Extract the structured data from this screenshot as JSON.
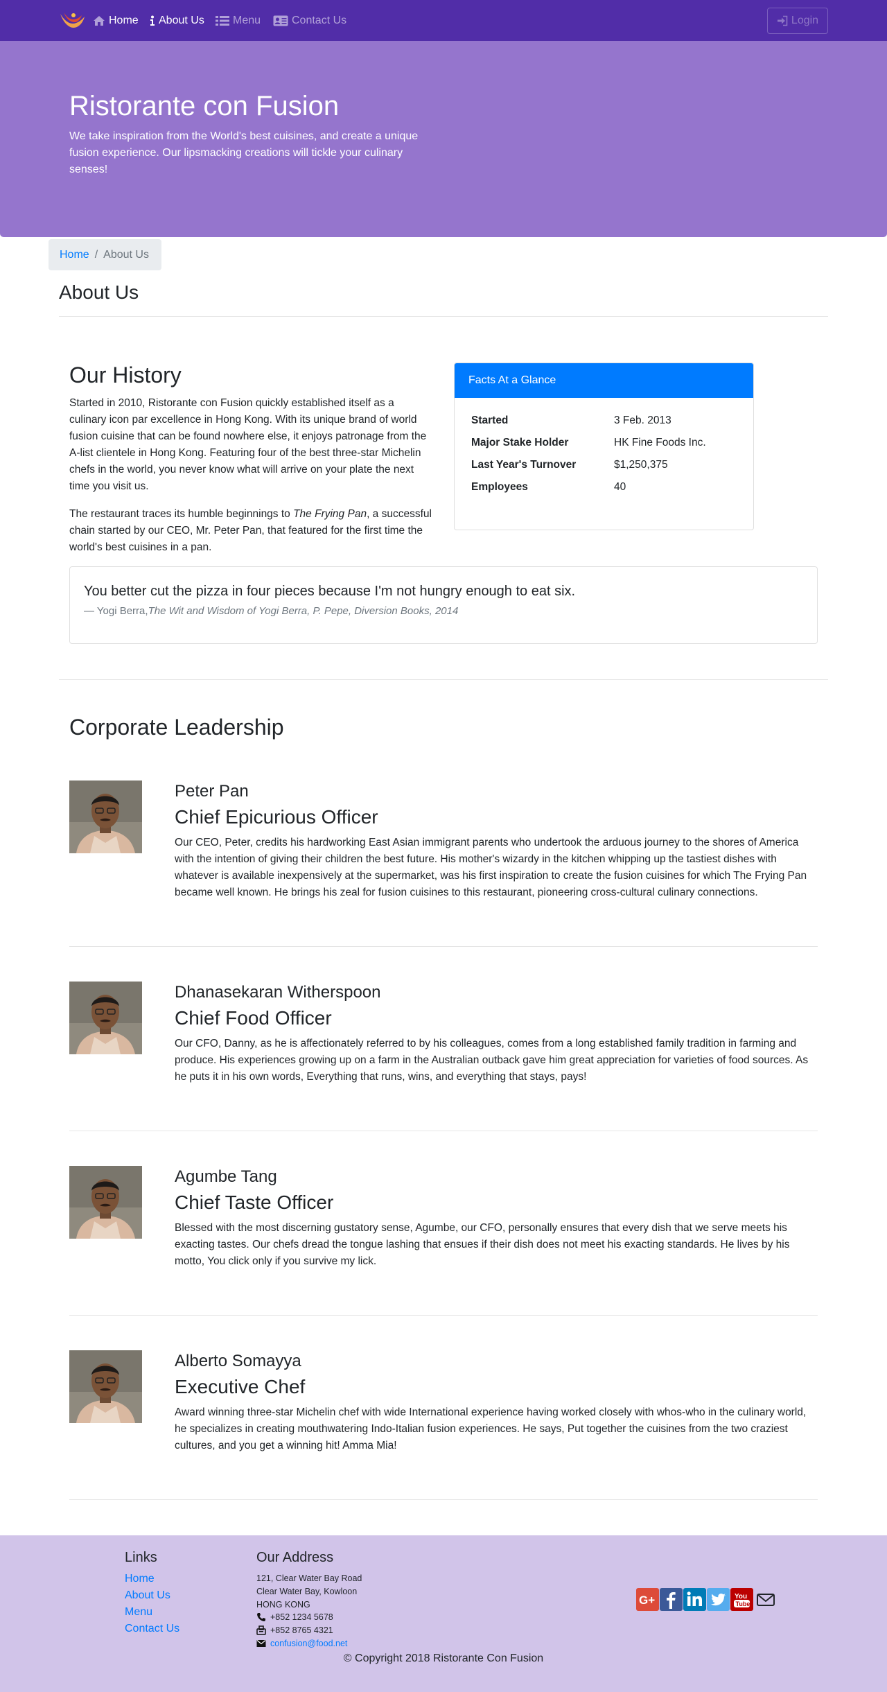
{
  "nav": {
    "items": [
      {
        "label": "Home"
      },
      {
        "label": "About Us"
      },
      {
        "label": "Menu"
      },
      {
        "label": "Contact Us"
      }
    ],
    "login_label": "Login"
  },
  "jumbotron": {
    "title": "Ristorante con Fusion",
    "text": "We take inspiration from the World's best cuisines, and create a unique fusion experience. Our lipsmacking creations will tickle your culinary senses!"
  },
  "breadcrumb": {
    "home": "Home",
    "current": "About Us"
  },
  "page_title": "About Us",
  "history": {
    "title": "Our History",
    "p1": "Started in 2010, Ristorante con Fusion quickly established itself as a culinary icon par excellence in Hong Kong. With its unique brand of world fusion cuisine that can be found nowhere else, it enjoys patronage from the A-list clientele in Hong Kong. Featuring four of the best three-star Michelin chefs in the world, you never know what will arrive on your plate the next time you visit us.",
    "p2_before": "The restaurant traces its humble beginnings to ",
    "p2_em": "The Frying Pan",
    "p2_after": ", a successful chain started by our CEO, Mr. Peter Pan, that featured for the first time the world's best cuisines in a pan."
  },
  "facts": {
    "header": "Facts At a Glance",
    "rows": [
      {
        "key": "Started",
        "value": "3 Feb. 2013"
      },
      {
        "key": "Major Stake Holder",
        "value": "HK Fine Foods Inc."
      },
      {
        "key": "Last Year's Turnover",
        "value": "$1,250,375"
      },
      {
        "key": "Employees",
        "value": "40"
      }
    ]
  },
  "quote": {
    "text": "You better cut the pizza in four pieces because I'm not hungry enough to eat six.",
    "author": "— Yogi Berra,",
    "cite": "The Wit and Wisdom of Yogi Berra, P. Pepe, Diversion Books, 2014"
  },
  "leadership": {
    "title": "Corporate Leadership",
    "leaders": [
      {
        "name": "Peter Pan",
        "role": "Chief Epicurious Officer",
        "description": "Our CEO, Peter, credits his hardworking East Asian immigrant parents who undertook the arduous journey to the shores of America with the intention of giving their children the best future. His mother's wizardy in the kitchen whipping up the tastiest dishes with whatever is available inexpensively at the supermarket, was his first inspiration to create the fusion cuisines for which The Frying Pan became well known. He brings his zeal for fusion cuisines to this restaurant, pioneering cross-cultural culinary connections."
      },
      {
        "name": "Dhanasekaran Witherspoon",
        "role": "Chief Food Officer",
        "description": "Our CFO, Danny, as he is affectionately referred to by his colleagues, comes from a long established family tradition in farming and produce. His experiences growing up on a farm in the Australian outback gave him great appreciation for varieties of food sources. As he puts it in his own words, Everything that runs, wins, and everything that stays, pays!"
      },
      {
        "name": "Agumbe Tang",
        "role": "Chief Taste Officer",
        "description": "Blessed with the most discerning gustatory sense, Agumbe, our CFO, personally ensures that every dish that we serve meets his exacting tastes. Our chefs dread the tongue lashing that ensues if their dish does not meet his exacting standards. He lives by his motto, You click only if you survive my lick."
      },
      {
        "name": "Alberto Somayya",
        "role": "Executive Chef",
        "description": "Award winning three-star Michelin chef with wide International experience having worked closely with whos-who in the culinary world, he specializes in creating mouthwatering Indo-Italian fusion experiences. He says, Put together the cuisines from the two craziest cultures, and you get a winning hit! Amma Mia!"
      }
    ]
  },
  "footer": {
    "links_heading": "Links",
    "links": [
      "Home",
      "About Us",
      "Menu",
      "Contact Us"
    ],
    "address_heading": "Our Address",
    "address_lines": [
      "121, Clear Water Bay Road",
      "Clear Water Bay, Kowloon",
      "HONG KONG"
    ],
    "phone": "+852 1234 5678",
    "fax": "+852 8765 4321",
    "email": "confusion@food.net",
    "social": [
      {
        "icon": "google-plus-icon",
        "color": "#dd4b39"
      },
      {
        "icon": "facebook-icon",
        "color": "#3b5998"
      },
      {
        "icon": "linkedin-icon",
        "color": "#007bb6"
      },
      {
        "icon": "twitter-icon",
        "color": "#55acee"
      },
      {
        "icon": "youtube-icon",
        "color": "#bb0000"
      },
      {
        "icon": "mail-icon",
        "color": "#212529"
      }
    ],
    "copyright": "© Copyright 2018 Ristorante Con Fusion"
  },
  "colors": {
    "primary": "#512DA8",
    "jumbotron": "#9575CD",
    "footer": "#D1C4E9",
    "link": "#007bff"
  }
}
